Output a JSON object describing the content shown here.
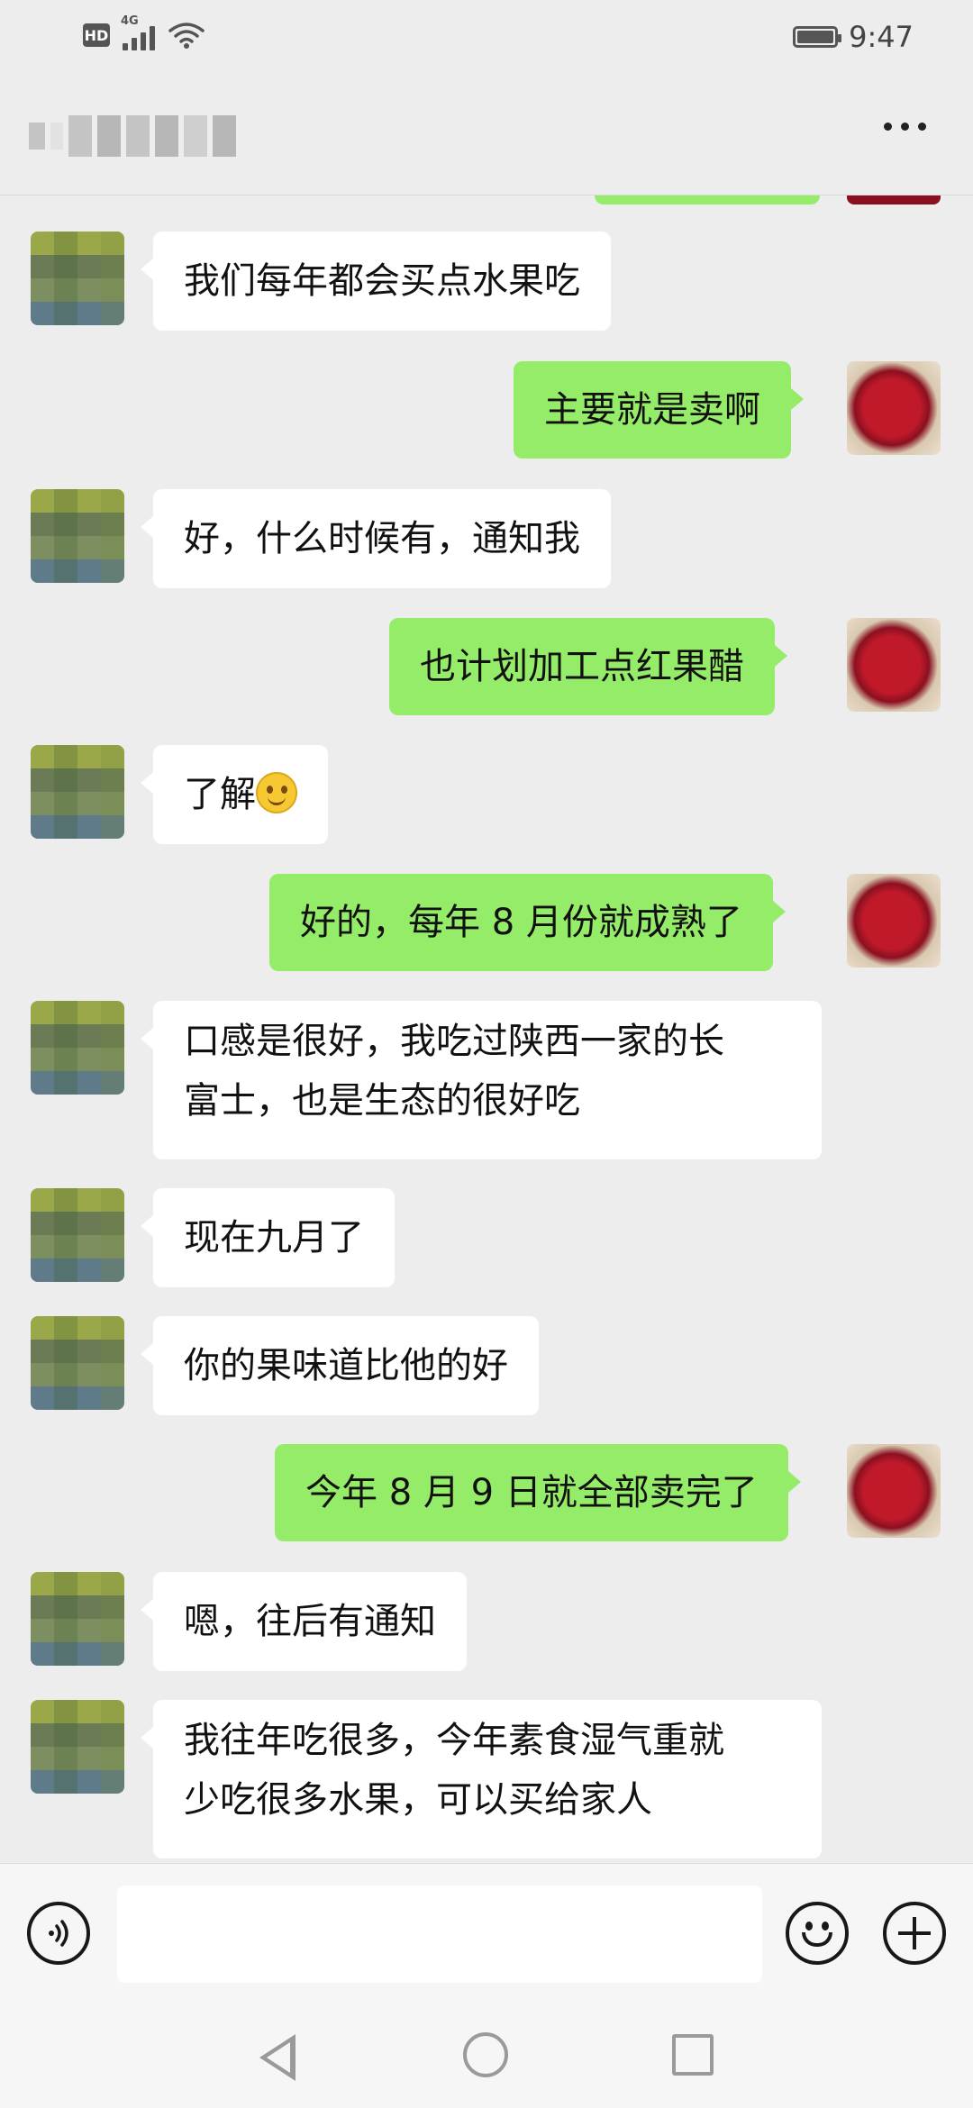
{
  "status_bar": {
    "hd": "HD",
    "network": "4G",
    "time": "9:47"
  },
  "header": {
    "contact_name": "",
    "more_icon": "more-icon"
  },
  "messages": [
    {
      "side": "left",
      "text": "我们每年都会买点水果吃"
    },
    {
      "side": "right",
      "text": "主要就是卖啊"
    },
    {
      "side": "left",
      "text": "好，什么时候有，通知我"
    },
    {
      "side": "right",
      "text": "也计划加工点红果醋"
    },
    {
      "side": "left",
      "text": "了解",
      "emoji": "smiling-face-emoji"
    },
    {
      "side": "right",
      "text": "好的，每年 8 月份就成熟了"
    },
    {
      "side": "left",
      "lines": [
        "口感是很好，我吃过陕西一家的长",
        "富士，也是生态的很好吃"
      ]
    },
    {
      "side": "left",
      "text": "现在九月了"
    },
    {
      "side": "left",
      "text": "你的果味道比他的好"
    },
    {
      "side": "right",
      "text": "今年 8 月 9 日就全部卖完了"
    },
    {
      "side": "left",
      "text": "嗯，往后有通知"
    },
    {
      "side": "left",
      "lines": [
        "我往年吃很多，今年素食湿气重就",
        "少吃很多水果，可以买给家人"
      ]
    }
  ],
  "input_bar": {
    "voice_icon": "voice-icon",
    "text_value": "",
    "emoji_icon": "emoji-icon",
    "plus_icon": "plus-icon"
  },
  "nav_bar": {
    "back_icon": "back-icon",
    "home_icon": "home-icon",
    "recents_icon": "recents-icon"
  }
}
